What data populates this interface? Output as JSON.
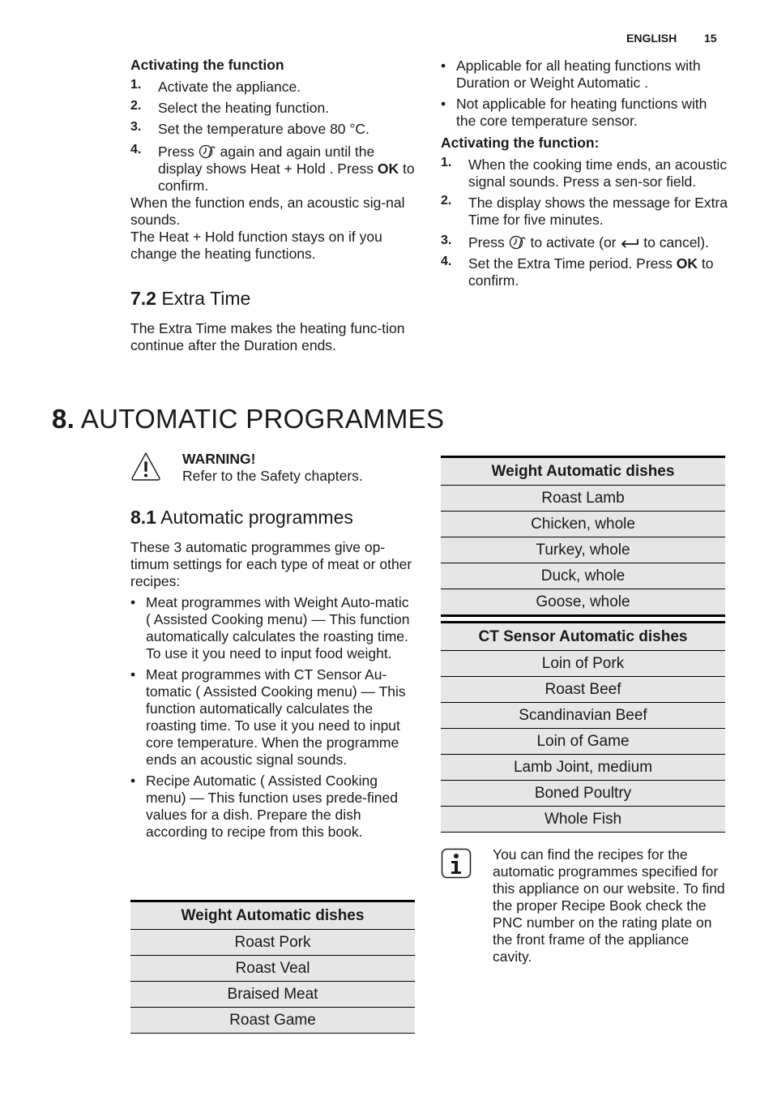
{
  "header": {
    "language": "ENGLISH",
    "page_number": "15"
  },
  "left_top": {
    "heading": "Activating the function",
    "steps": [
      {
        "num": "1.",
        "text": "Activate the appliance."
      },
      {
        "num": "2.",
        "text": "Select the heating function."
      },
      {
        "num": "3.",
        "text": "Set the temperature above 80 °C."
      },
      {
        "num": "4.",
        "pre": "Press",
        "icon": "extra-time-icon",
        "post": "again and again until the display shows Heat + Hold . Press",
        "bold": "OK",
        "end": "to confirm."
      }
    ],
    "para1": "When the function ends, an acoustic sig-nal sounds.",
    "para2": "The Heat + Hold function stays on if you change the heating functions."
  },
  "section_7_2": {
    "number": "7.2",
    "title": "Extra Time",
    "text": "The Extra Time makes the heating func-tion continue after the Duration ends."
  },
  "right_top": {
    "bullets": [
      "Applicable for all heating functions with Duration or Weight Automatic .",
      "Not applicable for heating functions with the core temperature sensor."
    ],
    "heading": "Activating the function:",
    "steps": [
      {
        "num": "1.",
        "text": "When the cooking time ends, an acoustic signal sounds. Press a sen-sor field."
      },
      {
        "num": "2.",
        "text": "The display shows the message for Extra Time for five minutes."
      },
      {
        "num": "3.",
        "pre": "Press",
        "icon": "extra-time-icon",
        "mid": "to activate (or",
        "icon2": "back-arrow-icon",
        "post": "to cancel)."
      },
      {
        "num": "4.",
        "pre": "Set the Extra Time period. Press",
        "bold": "OK",
        "post": "to confirm."
      }
    ]
  },
  "chapter_8": {
    "number": "8.",
    "title": "AUTOMATIC PROGRAMMES",
    "warning": {
      "title": "WARNING!",
      "text": "Refer to the Safety chapters."
    },
    "section_8_1": {
      "number": "8.1",
      "title": "Automatic programmes",
      "intro": "These 3 automatic programmes give op-timum settings for each type of meat or other recipes:",
      "bullets": [
        "Meat programmes with Weight Auto-matic ( Assisted Cooking menu) — This function automatically calculates the roasting time. To use it you need to input food weight.",
        "Meat programmes with CT Sensor Au-tomatic ( Assisted Cooking menu) — This function automatically calculates the roasting time. To use it you need to input core temperature. When the programme ends an acoustic signal sounds.",
        "Recipe Automatic ( Assisted Cooking menu) — This function uses prede-fined values for a dish. Prepare the dish according to recipe from this book."
      ]
    }
  },
  "tables": {
    "weight_left": {
      "header": "Weight Automatic dishes",
      "rows": [
        "Roast Pork",
        "Roast Veal",
        "Braised Meat",
        "Roast Game"
      ]
    },
    "weight_right": {
      "header": "Weight Automatic dishes",
      "rows": [
        "Roast Lamb",
        "Chicken, whole",
        "Turkey, whole",
        "Duck, whole",
        "Goose, whole"
      ]
    },
    "ct_sensor": {
      "header": "CT Sensor Automatic dishes",
      "rows": [
        "Loin of Pork",
        "Roast Beef",
        "Scandinavian Beef",
        "Loin of Game",
        "Lamb Joint, medium",
        "Boned Poultry",
        "Whole Fish"
      ]
    }
  },
  "info_note": {
    "text": "You can find the recipes for the automatic programmes specified for this appliance on our website. To find the proper Recipe Book check the PNC number on the rating plate on the front frame of the appliance cavity."
  }
}
